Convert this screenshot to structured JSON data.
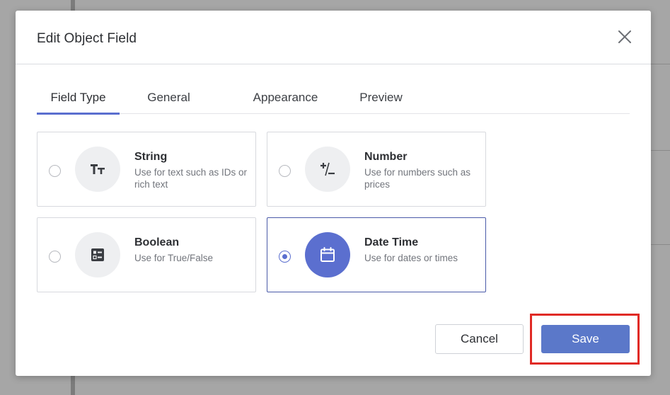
{
  "dialog": {
    "title": "Edit Object Field"
  },
  "tabs": [
    {
      "label": "Field Type",
      "active": true
    },
    {
      "label": "General",
      "active": false
    },
    {
      "label": "Appearance",
      "active": false
    },
    {
      "label": "Preview",
      "active": false
    }
  ],
  "field_types": [
    {
      "title": "String",
      "description": "Use for text such as IDs or rich text",
      "icon": "text-format-icon",
      "selected": false
    },
    {
      "title": "Number",
      "description": "Use for numbers such as prices",
      "icon": "plus-minus-icon",
      "selected": false
    },
    {
      "title": "Boolean",
      "description": "Use for True/False",
      "icon": "toggle-list-icon",
      "selected": false
    },
    {
      "title": "Date Time",
      "description": "Use for dates or times",
      "icon": "calendar-icon",
      "selected": true
    }
  ],
  "buttons": {
    "cancel": "Cancel",
    "save": "Save"
  },
  "colors": {
    "accent": "#5b6fcf",
    "save_button": "#5b78c9",
    "highlight": "#e02a25"
  }
}
